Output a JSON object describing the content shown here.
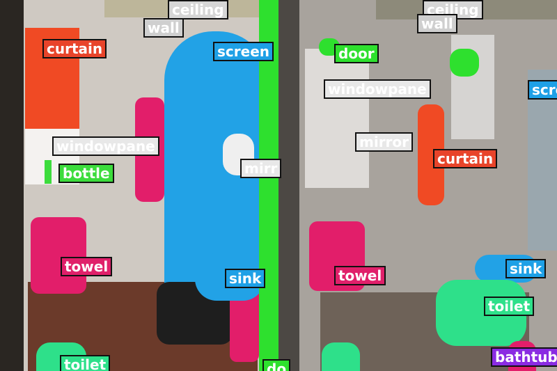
{
  "left_labels": [
    {
      "key": "ceiling",
      "text": "ceiling",
      "bg": "#d6d6d6",
      "fg": "#ffffff"
    },
    {
      "key": "wall",
      "text": "wall",
      "bg": "#cfcfcf",
      "fg": "#ffffff"
    },
    {
      "key": "curtain",
      "text": "curtain",
      "bg": "#e8442a",
      "fg": "#ffffff"
    },
    {
      "key": "screen",
      "text": "screen",
      "bg": "#1ea0e6",
      "fg": "#ffffff"
    },
    {
      "key": "windowpane",
      "text": "windowpane",
      "bg": "#e8e8e8",
      "fg": "#ffffff"
    },
    {
      "key": "bottle",
      "text": "bottle",
      "bg": "#3cdc3c",
      "fg": "#ffffff"
    },
    {
      "key": "mirror",
      "text": "mirr",
      "bg": "#e8e8e8",
      "fg": "#ffffff"
    },
    {
      "key": "towel",
      "text": "towel",
      "bg": "#e0206a",
      "fg": "#ffffff"
    },
    {
      "key": "sink",
      "text": "sink",
      "bg": "#1ea0e6",
      "fg": "#ffffff"
    },
    {
      "key": "toilet",
      "text": "toilet",
      "bg": "#2ee08a",
      "fg": "#ffffff"
    },
    {
      "key": "door",
      "text": "do",
      "bg": "#2ee02e",
      "fg": "#ffffff"
    }
  ],
  "right_labels": [
    {
      "key": "ceiling",
      "text": "ceiling",
      "bg": "#d6d6d6",
      "fg": "#ffffff"
    },
    {
      "key": "wall",
      "text": "wall",
      "bg": "#cfcfcf",
      "fg": "#ffffff"
    },
    {
      "key": "door",
      "text": "door",
      "bg": "#2ee02e",
      "fg": "#ffffff"
    },
    {
      "key": "screen",
      "text": "scre",
      "bg": "#1ea0e6",
      "fg": "#ffffff"
    },
    {
      "key": "windowpane",
      "text": "windowpane",
      "bg": "#e8e8e8",
      "fg": "#ffffff"
    },
    {
      "key": "mirror",
      "text": "mirror",
      "bg": "#e8e8e8",
      "fg": "#ffffff"
    },
    {
      "key": "curtain",
      "text": "curtain",
      "bg": "#e8442a",
      "fg": "#ffffff"
    },
    {
      "key": "towel",
      "text": "towel",
      "bg": "#e0206a",
      "fg": "#ffffff"
    },
    {
      "key": "sink",
      "text": "sink",
      "bg": "#1ea0e6",
      "fg": "#ffffff"
    },
    {
      "key": "toilet",
      "text": "toilet",
      "bg": "#2ee08a",
      "fg": "#ffffff"
    },
    {
      "key": "bathtub",
      "text": "bathtub",
      "bg": "#8a2be2",
      "fg": "#ffffff"
    }
  ]
}
